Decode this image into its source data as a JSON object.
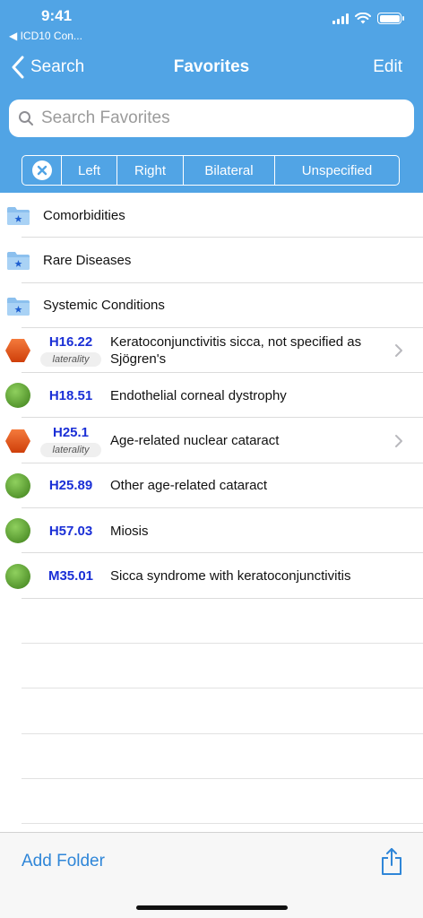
{
  "status_bar": {
    "time": "9:41",
    "back_app": "◀ ICD10 Con..."
  },
  "nav": {
    "back_label": "Search",
    "title": "Favorites",
    "edit_label": "Edit"
  },
  "search": {
    "placeholder": "Search Favorites",
    "value": ""
  },
  "segments": {
    "clear_icon": "x-circle-icon",
    "items": [
      "Left",
      "Right",
      "Bilateral",
      "Unspecified"
    ]
  },
  "folders": [
    {
      "label": "Comorbidities",
      "icon": "folder-star-icon"
    },
    {
      "label": "Rare Diseases",
      "icon": "folder-star-icon"
    },
    {
      "label": "Systemic Conditions",
      "icon": "folder-star-icon"
    }
  ],
  "codes": [
    {
      "code": "H16.22",
      "badge": "laterality",
      "description": "Keratoconjunctivitis sicca, not specified as Sjögren's",
      "status": "hexagon-orange",
      "chevron": true
    },
    {
      "code": "H18.51",
      "badge": "",
      "description": "Endothelial corneal dystrophy",
      "status": "circle-green",
      "chevron": false
    },
    {
      "code": "H25.1",
      "badge": "laterality",
      "description": "Age-related nuclear cataract",
      "status": "hexagon-orange",
      "chevron": true
    },
    {
      "code": "H25.89",
      "badge": "",
      "description": "Other age-related cataract",
      "status": "circle-green",
      "chevron": false
    },
    {
      "code": "H57.03",
      "badge": "",
      "description": "Miosis",
      "status": "circle-green",
      "chevron": false
    },
    {
      "code": "M35.01",
      "badge": "",
      "description": "Sicca syndrome with keratoconjunctivitis",
      "status": "circle-green",
      "chevron": false
    }
  ],
  "toolbar": {
    "add_folder_label": "Add Folder",
    "share_icon": "share-icon"
  },
  "colors": {
    "header": "#51a4e5",
    "code_text": "#1a2fd6",
    "link": "#2f86d8",
    "green_status": "#5fa33a",
    "orange_status": "#e8541a"
  }
}
